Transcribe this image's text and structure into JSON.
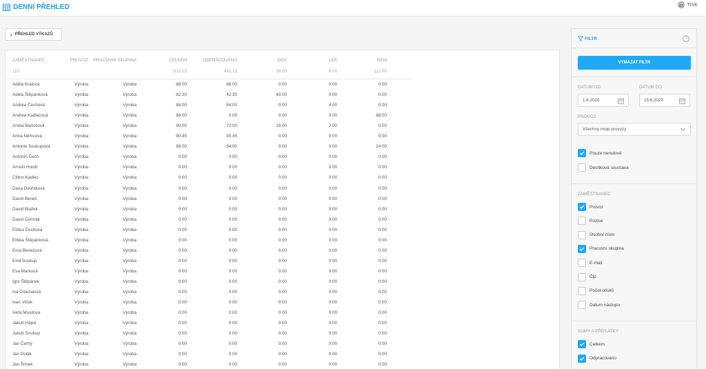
{
  "app": {
    "title": "DENNÍ PŘEHLED",
    "print_label": "TISK"
  },
  "back_button": {
    "label": "PŘEHLED VÝKAZŮ"
  },
  "table": {
    "headers": [
      "ZAMĚSTNANEC",
      "PROVOZ",
      "PRACOVNÍ SKUPINA",
      "CELKEM",
      "ODPRACOVÁNO",
      "DOV",
      "LEK",
      "NEM"
    ],
    "summary": {
      "employees": "110",
      "celkem": "615:15",
      "odpracovano": "441:15",
      "dov": "56:00",
      "lek": "6:00",
      "nem": "112:00"
    },
    "rows": [
      [
        "Adéla Králová",
        "Výroba",
        "Výroba",
        "88:00",
        "88:00",
        "0:00",
        "0:00",
        "0:00"
      ],
      [
        "Adéla Štěpánková",
        "Výroba",
        "Výroba",
        "82:30",
        "42:30",
        "40:00",
        "0:00",
        "0:00"
      ],
      [
        "Andrea Čechová",
        "Výroba",
        "Výroba",
        "88:00",
        "84:00",
        "0:00",
        "4:00",
        "0:00"
      ],
      [
        "Andrea Kadlecová",
        "Výroba",
        "Výroba",
        "88:00",
        "0:00",
        "0:00",
        "0:00",
        "88:00"
      ],
      [
        "Aneta Bartošová",
        "Výroba",
        "Výroba",
        "90:00",
        "72:00",
        "16:00",
        "2:00",
        "0:00"
      ],
      [
        "Anna Němcová",
        "Výroba",
        "Výroba",
        "90:45",
        "90:45",
        "0:00",
        "0:00",
        "0:00"
      ],
      [
        "Antonie Soukupová",
        "Výroba",
        "Výroba",
        "88:00",
        "64:00",
        "0:00",
        "0:00",
        "24:00"
      ],
      [
        "Antonín Čech",
        "Výroba",
        "Výroba",
        "0:00",
        "0:00",
        "0:00",
        "0:00",
        "0:00"
      ],
      [
        "Arnošt Holub",
        "Výroba",
        "Výroba",
        "0:00",
        "0:00",
        "0:00",
        "0:00",
        "0:00"
      ],
      [
        "Ctibor Kadlec",
        "Výroba",
        "Výroba",
        "0:00",
        "0:00",
        "0:00",
        "0:00",
        "0:00"
      ],
      [
        "Dana Dvořáková",
        "Výroba",
        "Výroba",
        "0:00",
        "0:00",
        "0:00",
        "0:00",
        "0:00"
      ],
      [
        "David Beneš",
        "Výroba",
        "Výroba",
        "0:00",
        "0:00",
        "0:00",
        "0:00",
        "0:00"
      ],
      [
        "David Blažek",
        "Výroba",
        "Výroba",
        "0:00",
        "0:00",
        "0:00",
        "0:00",
        "0:00"
      ],
      [
        "David Čermák",
        "Výroba",
        "Výroba",
        "0:00",
        "0:00",
        "0:00",
        "0:00",
        "0:00"
      ],
      [
        "Eliška Čechová",
        "Výroba",
        "Výroba",
        "0:00",
        "0:00",
        "0:00",
        "0:00",
        "0:00"
      ],
      [
        "Eliška Štěpánková",
        "Výroba",
        "Výroba",
        "0:00",
        "0:00",
        "0:00",
        "0:00",
        "0:00"
      ],
      [
        "Ema Benešová",
        "Výroba",
        "Výroba",
        "0:00",
        "0:00",
        "0:00",
        "0:00",
        "0:00"
      ],
      [
        "Emil Soukup",
        "Výroba",
        "Výroba",
        "0:00",
        "0:00",
        "0:00",
        "0:00",
        "0:00"
      ],
      [
        "Eva Marková",
        "Výroba",
        "Výroba",
        "0:00",
        "0:00",
        "0:00",
        "0:00",
        "0:00"
      ],
      [
        "Igor Štěpánek",
        "Výroba",
        "Výroba",
        "0:00",
        "0:00",
        "0:00",
        "0:00",
        "0:00"
      ],
      [
        "Iva Doležalová",
        "Výroba",
        "Výroba",
        "0:00",
        "0:00",
        "0:00",
        "0:00",
        "0:00"
      ],
      [
        "Ivan Vlček",
        "Výroba",
        "Výroba",
        "0:00",
        "0:00",
        "0:00",
        "0:00",
        "0:00"
      ],
      [
        "Iveta Musilová",
        "Výroba",
        "Výroba",
        "0:00",
        "0:00",
        "0:00",
        "0:00",
        "0:00"
      ],
      [
        "Jakub Hájek",
        "Výroba",
        "Výroba",
        "0:00",
        "0:00",
        "0:00",
        "0:00",
        "0:00"
      ],
      [
        "Jakub Soukup",
        "Výroba",
        "Výroba",
        "0:00",
        "0:00",
        "0:00",
        "0:00",
        "0:00"
      ],
      [
        "Jan Černý",
        "Výroba",
        "Výroba",
        "0:00",
        "0:00",
        "0:00",
        "0:00",
        "0:00"
      ],
      [
        "Jan Polák",
        "Výroba",
        "Výroba",
        "0:00",
        "0:00",
        "0:00",
        "0:00",
        "0:00"
      ],
      [
        "Jan Šimek",
        "Výroba",
        "Výroba",
        "0:00",
        "0:00",
        "0:00",
        "0:00",
        "0:00"
      ]
    ]
  },
  "filter": {
    "title": "FILTR",
    "help": "?",
    "clear_label": "VYMAZAT FILTR",
    "date_from_label": "DATUM OD",
    "date_from_value": "1.6.2020",
    "date_to_label": "DATUM DO",
    "date_to_value": "15.6.2020",
    "provoz_label": "PROVOZ",
    "provoz_value": "Všechny moje provozy",
    "options": [
      {
        "label": "Pouze nenulové",
        "checked": true
      },
      {
        "label": "Desítková soustava",
        "checked": false
      }
    ],
    "employee_section": {
      "title": "ZAMĚSTNANEC",
      "items": [
        {
          "label": "Provoz",
          "checked": true
        },
        {
          "label": "Pozice",
          "checked": false
        },
        {
          "label": "Osobní číslo",
          "checked": false
        },
        {
          "label": "Pracovní skupina",
          "checked": true
        },
        {
          "label": "E-mail",
          "checked": false
        },
        {
          "label": "Čip",
          "checked": false
        },
        {
          "label": "Počet otisků",
          "checked": false
        },
        {
          "label": "Datum nástupu",
          "checked": false
        }
      ]
    },
    "sums_section": {
      "title": "SUMY A PŘÍPLATKY",
      "items": [
        {
          "label": "Celkem",
          "checked": true
        },
        {
          "label": "Odpracováno",
          "checked": true
        }
      ]
    }
  },
  "colors": {
    "accent": "#1fa2dc",
    "button": "#1fa9f4"
  }
}
